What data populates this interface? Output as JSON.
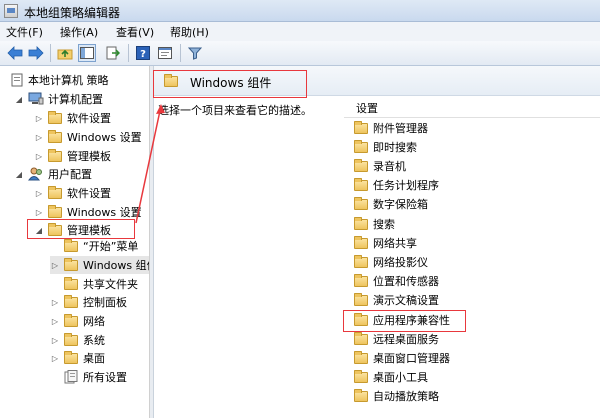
{
  "window": {
    "title": "本地组策略编辑器"
  },
  "menu": [
    "文件(F)",
    "操作(A)",
    "查看(V)",
    "帮助(H)"
  ],
  "tree": {
    "root": "本地计算机 策略",
    "computer": "计算机配置",
    "computer_children": [
      "软件设置",
      "Windows 设置",
      "管理模板"
    ],
    "user": "用户配置",
    "user_children": [
      "软件设置",
      "Windows 设置",
      "管理模板"
    ],
    "admin_children": [
      "“开始”菜单",
      "Windows 组件",
      "共享文件夹",
      "控制面板",
      "网络",
      "系统",
      "桌面",
      "所有设置"
    ]
  },
  "content": {
    "header_title": "Windows 组件",
    "description": "选择一个项目来查看它的描述。",
    "column_header": "设置",
    "items": [
      "附件管理器",
      "即时搜索",
      "录音机",
      "任务计划程序",
      "数字保险箱",
      "搜索",
      "网络共享",
      "网络投影仪",
      "位置和传感器",
      "演示文稿设置",
      "应用程序兼容性",
      "远程桌面服务",
      "桌面窗口管理器",
      "桌面小工具",
      "自动播放策略"
    ]
  },
  "colors": {
    "highlight": "#e8383d"
  }
}
